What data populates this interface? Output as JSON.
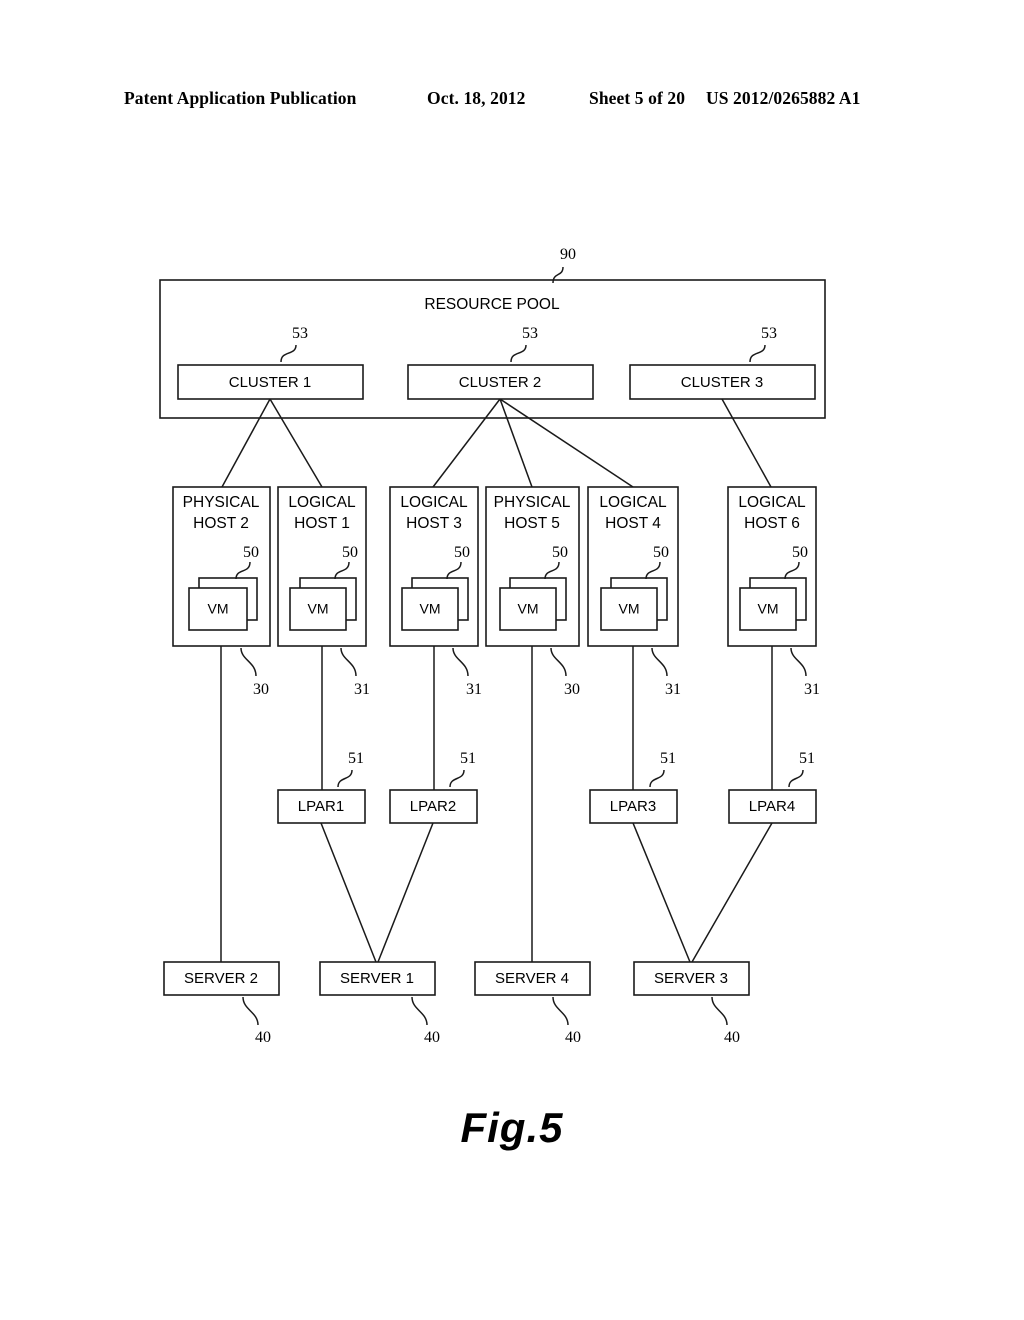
{
  "header": {
    "publication": "Patent Application Publication",
    "date": "Oct. 18, 2012",
    "sheet": "Sheet 5 of 20",
    "number": "US 2012/0265882 A1"
  },
  "figure": {
    "caption": "Fig.5"
  },
  "diagram": {
    "pool": {
      "label": "RESOURCE POOL",
      "ref": "90"
    },
    "clusters": [
      {
        "label": "CLUSTER 1",
        "ref": "53"
      },
      {
        "label": "CLUSTER 2",
        "ref": "53"
      },
      {
        "label": "CLUSTER 3",
        "ref": "53"
      }
    ],
    "hosts": [
      {
        "line1": "PHYSICAL",
        "line2": "HOST 2",
        "vm_label": "VM",
        "vm_ref": "50",
        "link_ref": "30"
      },
      {
        "line1": "LOGICAL",
        "line2": "HOST 1",
        "vm_label": "VM",
        "vm_ref": "50",
        "link_ref": "31"
      },
      {
        "line1": "LOGICAL",
        "line2": "HOST 3",
        "vm_label": "VM",
        "vm_ref": "50",
        "link_ref": "31"
      },
      {
        "line1": "PHYSICAL",
        "line2": "HOST 5",
        "vm_label": "VM",
        "vm_ref": "50",
        "link_ref": "30"
      },
      {
        "line1": "LOGICAL",
        "line2": "HOST 4",
        "vm_label": "VM",
        "vm_ref": "50",
        "link_ref": "31"
      },
      {
        "line1": "LOGICAL",
        "line2": "HOST 6",
        "vm_label": "VM",
        "vm_ref": "50",
        "link_ref": "31"
      }
    ],
    "lpars": [
      {
        "label": "LPAR1",
        "ref": "51"
      },
      {
        "label": "LPAR2",
        "ref": "51"
      },
      {
        "label": "LPAR3",
        "ref": "51"
      },
      {
        "label": "LPAR4",
        "ref": "51"
      }
    ],
    "servers": [
      {
        "label": "SERVER 2",
        "ref": "40"
      },
      {
        "label": "SERVER 1",
        "ref": "40"
      },
      {
        "label": "SERVER 4",
        "ref": "40"
      },
      {
        "label": "SERVER 3",
        "ref": "40"
      }
    ]
  }
}
